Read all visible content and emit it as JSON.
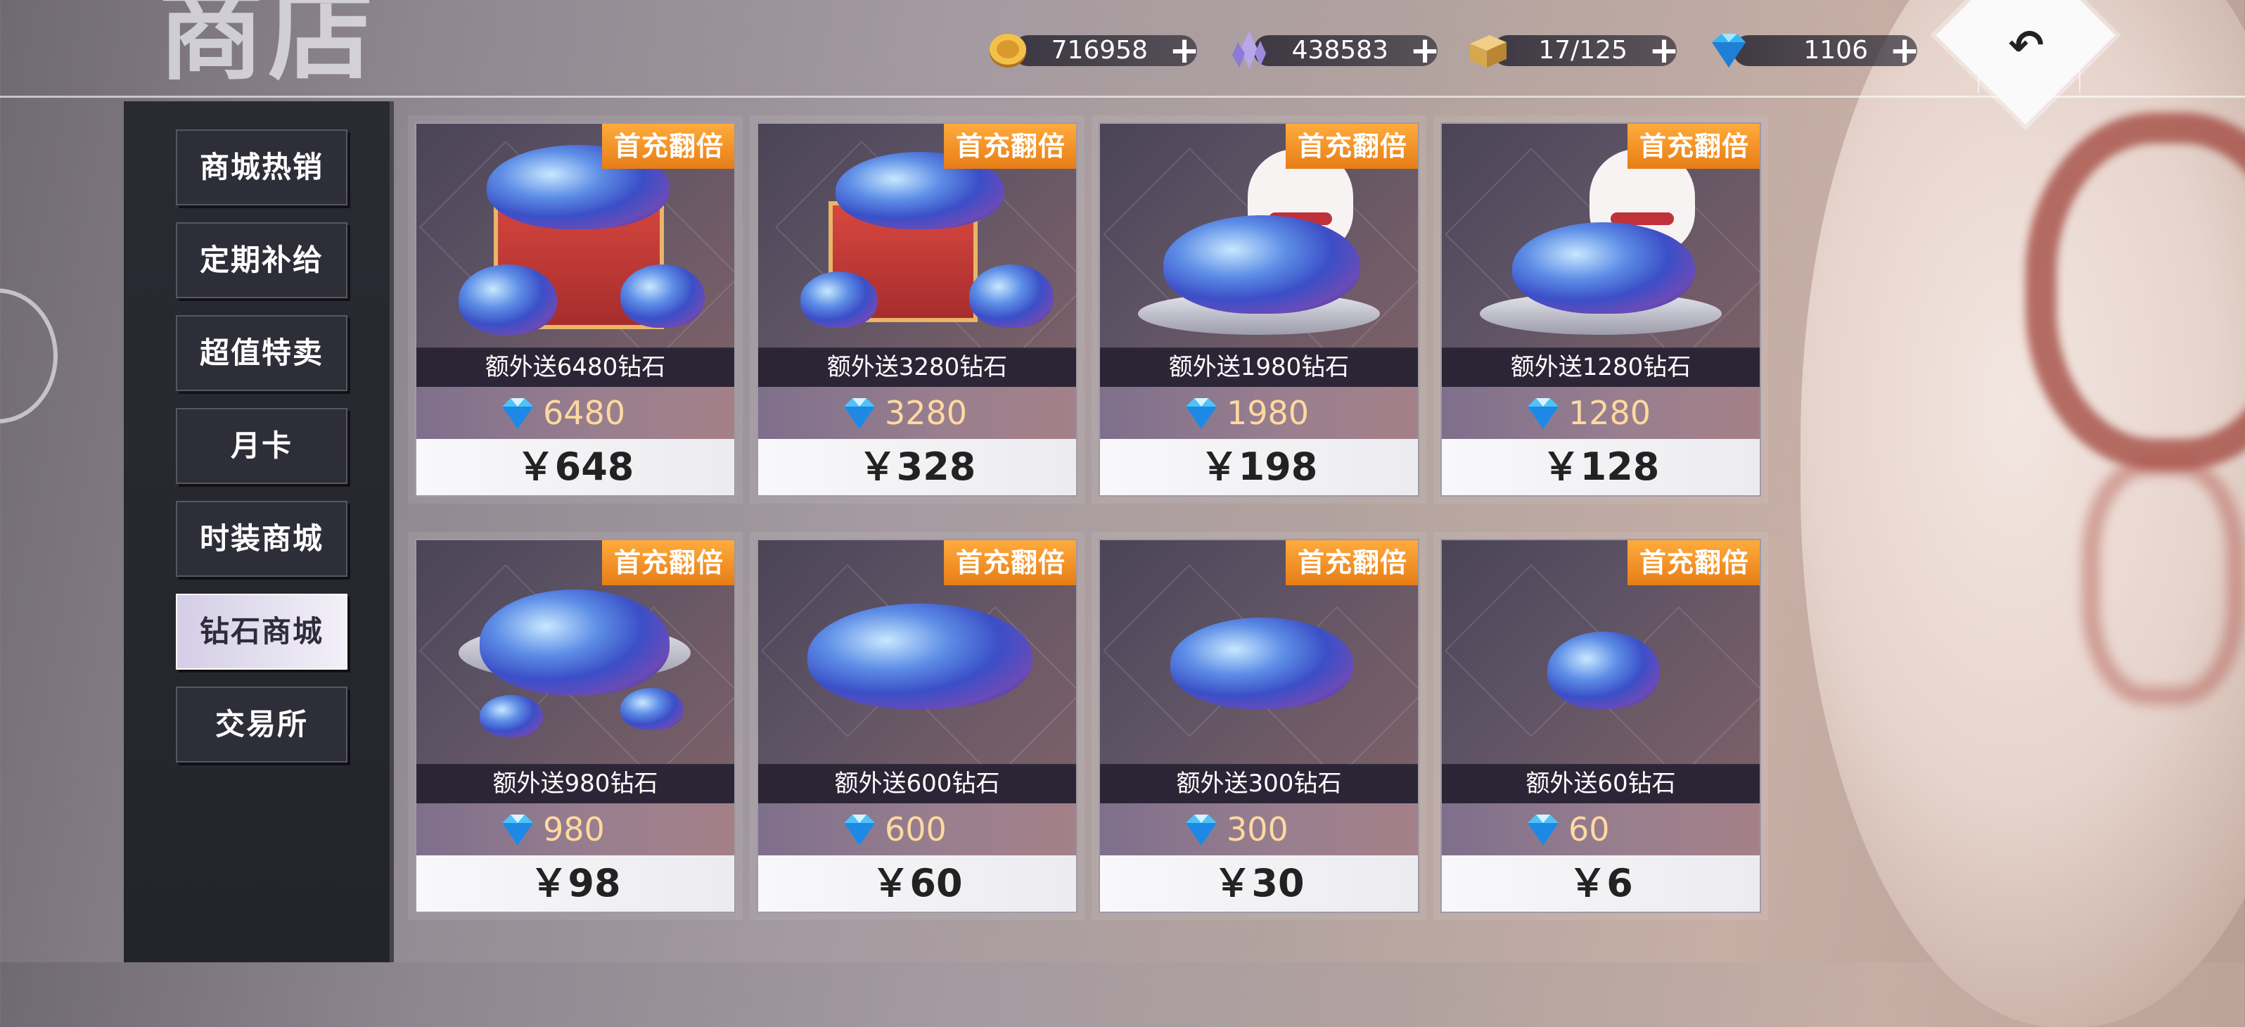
{
  "header": {
    "title": "商店",
    "back_icon": "return-arrow-icon"
  },
  "resources": [
    {
      "name": "gold-coin",
      "icon": "gold-coin-icon",
      "value": "716958"
    },
    {
      "name": "purple-crystal",
      "icon": "purple-crystal-icon",
      "value": "438583"
    },
    {
      "name": "stamina",
      "icon": "bread-box-icon",
      "value": "17/125"
    },
    {
      "name": "diamond",
      "icon": "diamond-icon",
      "value": "1106"
    }
  ],
  "sidebar": {
    "items": [
      {
        "label": "商城热销"
      },
      {
        "label": "定期补给"
      },
      {
        "label": "超值特卖"
      },
      {
        "label": "月卡"
      },
      {
        "label": "时装商城"
      },
      {
        "label": "钻石商城",
        "active": true
      },
      {
        "label": "交易所"
      }
    ]
  },
  "products": [
    {
      "badge": "首充翻倍",
      "bonus": "额外送6480钻石",
      "diamonds": "6480",
      "price": "￥648",
      "art": "treasure-chest"
    },
    {
      "badge": "首充翻倍",
      "bonus": "额外送3280钻石",
      "diamonds": "3280",
      "price": "￥328",
      "art": "treasure-box"
    },
    {
      "badge": "首充翻倍",
      "bonus": "额外送1980钻石",
      "diamonds": "1980",
      "price": "￥198",
      "art": "lucky-cat-plate"
    },
    {
      "badge": "首充翻倍",
      "bonus": "额外送1280钻石",
      "diamonds": "1280",
      "price": "￥128",
      "art": "lucky-cat-plate"
    },
    {
      "badge": "首充翻倍",
      "bonus": "额外送980钻石",
      "diamonds": "980",
      "price": "￥98",
      "art": "gem-plate"
    },
    {
      "badge": "首充翻倍",
      "bonus": "额外送600钻石",
      "diamonds": "600",
      "price": "￥60",
      "art": "gem-pile"
    },
    {
      "badge": "首充翻倍",
      "bonus": "额外送300钻石",
      "diamonds": "300",
      "price": "￥30",
      "art": "gem-cluster"
    },
    {
      "badge": "首充翻倍",
      "bonus": "额外送60钻石",
      "diamonds": "60",
      "price": "￥6",
      "art": "gem-small"
    }
  ],
  "colors": {
    "badge": "#f0901f",
    "diamond_amount": "#ffd9a0",
    "sidebar": "#2a2a33",
    "active_tab": "#ece8f5"
  }
}
